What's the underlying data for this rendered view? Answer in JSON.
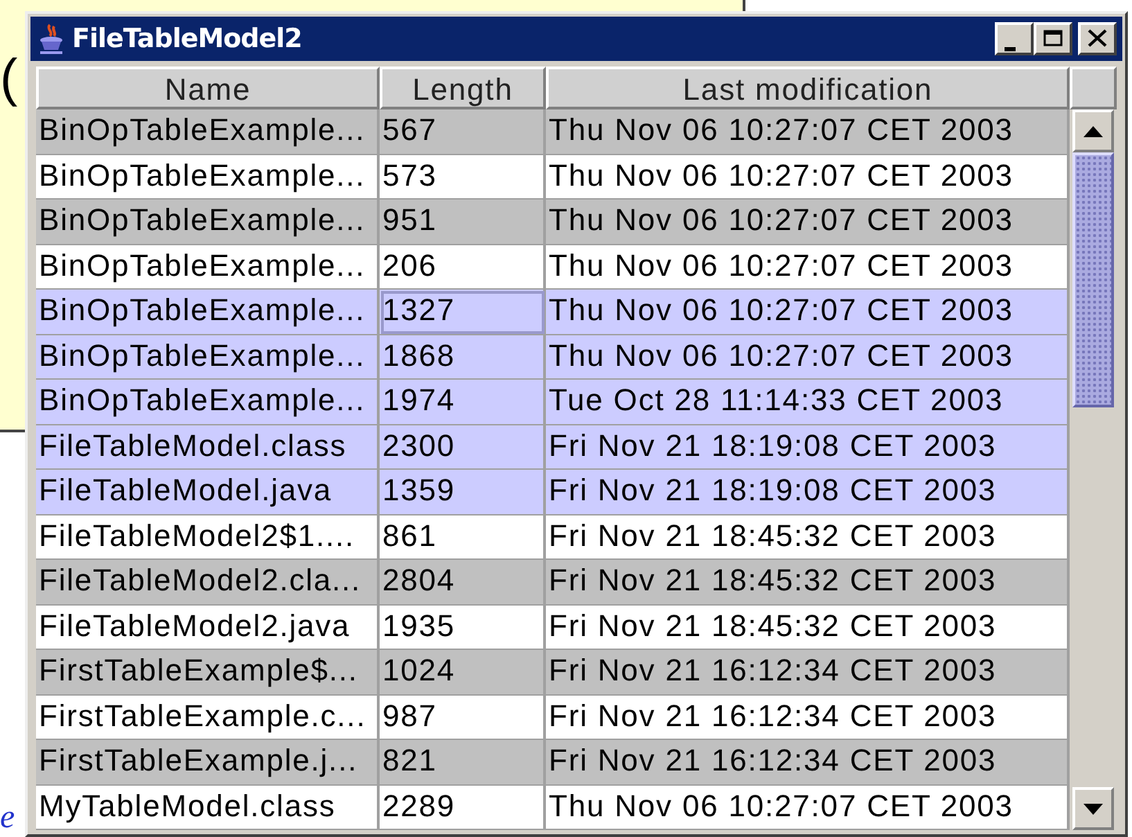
{
  "backdrop": {
    "paren": "(",
    "fragment": "e"
  },
  "window": {
    "title": "FileTableModel2"
  },
  "table": {
    "columns": [
      "Name",
      "Length",
      "Last modification"
    ],
    "rows": [
      {
        "name": "BinOpTableExample...",
        "length": "567",
        "modified": "Thu Nov 06 10:27:07 CET 2003",
        "selected": false,
        "focused": false
      },
      {
        "name": "BinOpTableExample...",
        "length": "573",
        "modified": "Thu Nov 06 10:27:07 CET 2003",
        "selected": false,
        "focused": false
      },
      {
        "name": "BinOpTableExample...",
        "length": "951",
        "modified": "Thu Nov 06 10:27:07 CET 2003",
        "selected": false,
        "focused": false
      },
      {
        "name": "BinOpTableExample...",
        "length": "206",
        "modified": "Thu Nov 06 10:27:07 CET 2003",
        "selected": false,
        "focused": false
      },
      {
        "name": "BinOpTableExample...",
        "length": "1327",
        "modified": "Thu Nov 06 10:27:07 CET 2003",
        "selected": true,
        "focused": true
      },
      {
        "name": "BinOpTableExample...",
        "length": "1868",
        "modified": "Thu Nov 06 10:27:07 CET 2003",
        "selected": true,
        "focused": false
      },
      {
        "name": "BinOpTableExample...",
        "length": "1974",
        "modified": "Tue Oct 28 11:14:33 CET 2003",
        "selected": true,
        "focused": false
      },
      {
        "name": "FileTableModel.class",
        "length": "2300",
        "modified": "Fri Nov 21 18:19:08 CET 2003",
        "selected": true,
        "focused": false
      },
      {
        "name": "FileTableModel.java",
        "length": "1359",
        "modified": "Fri Nov 21 18:19:08 CET 2003",
        "selected": true,
        "focused": false
      },
      {
        "name": "FileTableModel2$1....",
        "length": "861",
        "modified": "Fri Nov 21 18:45:32 CET 2003",
        "selected": false,
        "focused": false
      },
      {
        "name": "FileTableModel2.cla...",
        "length": "2804",
        "modified": "Fri Nov 21 18:45:32 CET 2003",
        "selected": false,
        "focused": false
      },
      {
        "name": "FileTableModel2.java",
        "length": "1935",
        "modified": "Fri Nov 21 18:45:32 CET 2003",
        "selected": false,
        "focused": false
      },
      {
        "name": "FirstTableExample$...",
        "length": "1024",
        "modified": "Fri Nov 21 16:12:34 CET 2003",
        "selected": false,
        "focused": false
      },
      {
        "name": "FirstTableExample.c...",
        "length": "987",
        "modified": "Fri Nov 21 16:12:34 CET 2003",
        "selected": false,
        "focused": false
      },
      {
        "name": "FirstTableExample.j...",
        "length": "821",
        "modified": "Fri Nov 21 16:12:34 CET 2003",
        "selected": false,
        "focused": false
      },
      {
        "name": "MyTableModel.class",
        "length": "2289",
        "modified": "Thu Nov 06 10:27:07 CET 2003",
        "selected": false,
        "focused": false
      }
    ]
  }
}
